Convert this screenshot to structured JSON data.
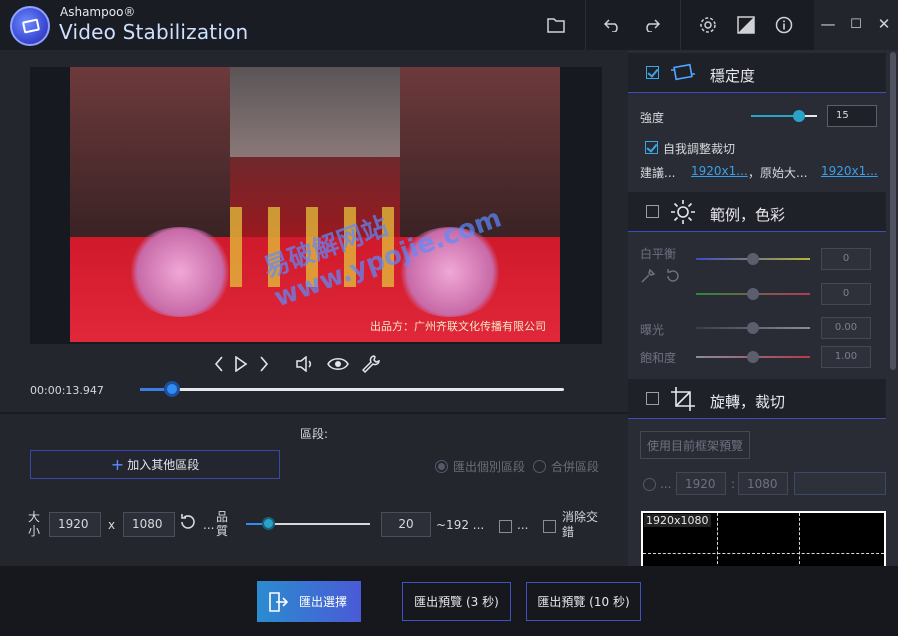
{
  "app": {
    "brand_small": "Ashampoo®",
    "brand_big": "Video Stabilization"
  },
  "toolbar": {
    "icons": [
      "folder-icon",
      "undo-icon",
      "redo-icon",
      "settings-icon",
      "contrast-icon",
      "info-icon"
    ]
  },
  "window_controls": {
    "minimize": "—",
    "maximize": "☐",
    "close": "✕"
  },
  "player": {
    "video_caption": "出品方：广州齐联文化传播有限公司",
    "watermark": "易破解网站 www.ypojie.com",
    "time": "00:00:13.947",
    "progress": 0.075
  },
  "segments": {
    "title": "區段:",
    "add_button": "加入其他區段",
    "export_each": "匯出個別區段",
    "merge": "合併區段"
  },
  "output": {
    "size_label": "大小",
    "width": "1920",
    "x": "x",
    "height": "1080",
    "quality_label": "品質",
    "quality_value": "20",
    "quality_progress": 0.18,
    "estimate": "~192 ...",
    "ellipsis": "...",
    "remove_label": "消除交錯"
  },
  "bottom": {
    "export_selection": "匯出選擇",
    "export_preview_3": "匯出預覽 (3 秒)",
    "export_preview_10": "匯出預覽 (10 秒)"
  },
  "stability": {
    "title": "穩定度",
    "enabled": true,
    "strength_label": "強度",
    "strength_value": "15",
    "strength_progress": 0.72,
    "auto_crop_label": "自我調整裁切",
    "auto_crop": true,
    "suggest_label": "建議...",
    "suggest_value": "1920x1...",
    "original_label": "，原始大...",
    "original_value": "1920x1..."
  },
  "color": {
    "title": "範例，色彩",
    "enabled": false,
    "white_balance_label": "白平衡",
    "wb1_value": "0",
    "wb2_value": "0",
    "exposure_label": "曝光",
    "exposure_value": "0.00",
    "saturation_label": "飽和度",
    "saturation_value": "1.00"
  },
  "rotate": {
    "title": "旋轉，裁切",
    "enabled": false,
    "use_frame_button": "使用目前框架預覽",
    "width": "1920",
    "sep": ":",
    "height": "1080",
    "preview_label": "1920x1080"
  },
  "colors": {
    "accent": "#3b4cc0",
    "link": "#3b9fe8",
    "export_gradient_start": "#2b8ccf",
    "export_gradient_end": "#4a5ad6"
  }
}
